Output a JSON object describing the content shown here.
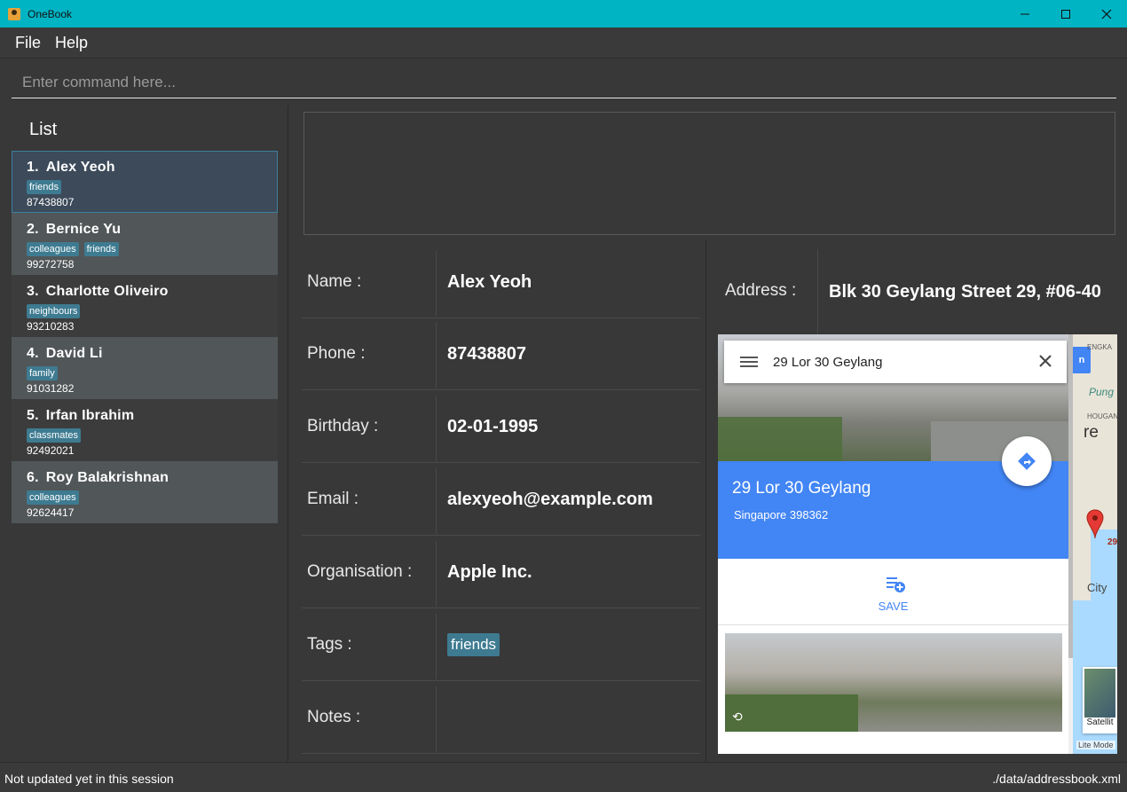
{
  "window": {
    "title": "OneBook"
  },
  "menu": {
    "file": "File",
    "help": "Help"
  },
  "command": {
    "placeholder": "Enter command here..."
  },
  "list": {
    "title": "List",
    "persons": [
      {
        "index": "1.",
        "name": "Alex Yeoh",
        "tags": [
          "friends"
        ],
        "phone": "87438807"
      },
      {
        "index": "2.",
        "name": "Bernice Yu",
        "tags": [
          "colleagues",
          "friends"
        ],
        "phone": "99272758"
      },
      {
        "index": "3.",
        "name": "Charlotte Oliveiro",
        "tags": [
          "neighbours"
        ],
        "phone": "93210283"
      },
      {
        "index": "4.",
        "name": "David Li",
        "tags": [
          "family"
        ],
        "phone": "91031282"
      },
      {
        "index": "5.",
        "name": "Irfan Ibrahim",
        "tags": [
          "classmates"
        ],
        "phone": "92492021"
      },
      {
        "index": "6.",
        "name": "Roy Balakrishnan",
        "tags": [
          "colleagues"
        ],
        "phone": "92624417"
      }
    ]
  },
  "details": {
    "name_label": "Name :",
    "name": "Alex Yeoh",
    "phone_label": "Phone :",
    "phone": "87438807",
    "birthday_label": "Birthday :",
    "birthday": "02-01-1995",
    "email_label": "Email :",
    "email": "alexyeoh@example.com",
    "organisation_label": "Organisation :",
    "organisation": "Apple Inc.",
    "tags_label": "Tags :",
    "tags": [
      "friends"
    ],
    "notes_label": "Notes :",
    "notes": "",
    "address_label": "Address :",
    "address": "Blk 30 Geylang Street 29, #06-40"
  },
  "map": {
    "search_text": "29 Lor 30 Geylang",
    "place_name": "29 Lor 30 Geylang",
    "place_sub": "Singapore 398362",
    "save_label": "SAVE",
    "labels": [
      "ENGKA",
      "Pung",
      "HOUGANG",
      "re",
      "City",
      "29"
    ],
    "blue_chip": "n",
    "satellite_label": "Satellit",
    "lite_mode": "Lite Mode",
    "water_color": "#aadaff",
    "accent": "#4285f4"
  },
  "status": {
    "left": "Not updated yet in this session",
    "right": "./data/addressbook.xml"
  },
  "colors": {
    "title_bar": "#00b4c4",
    "tag": "#3e7b91",
    "background": "#383838"
  }
}
